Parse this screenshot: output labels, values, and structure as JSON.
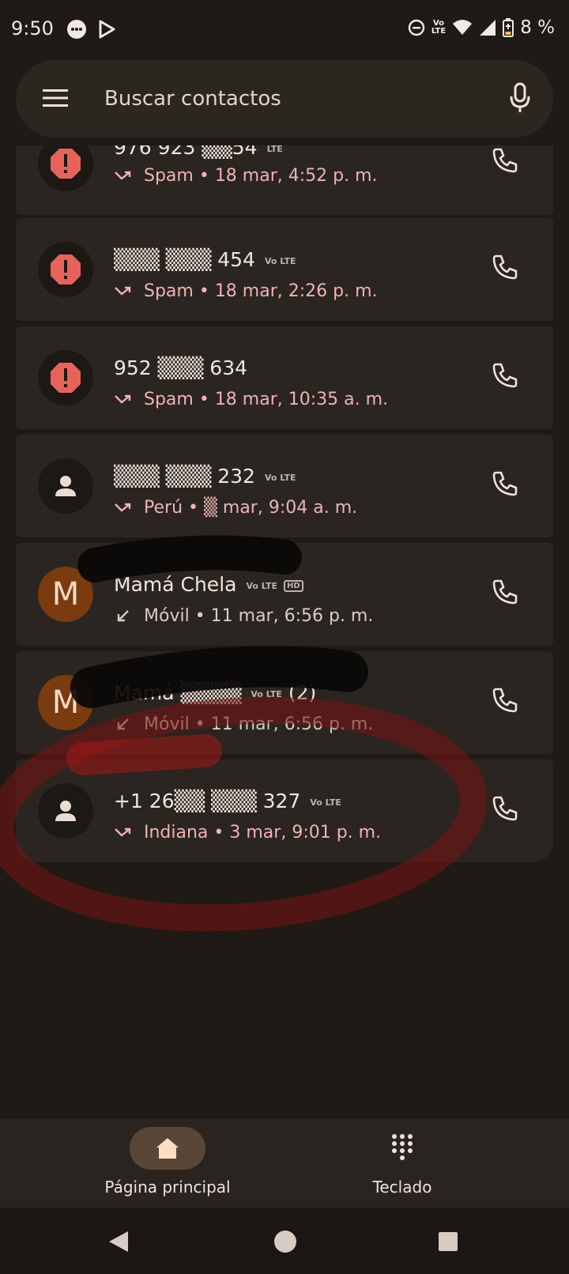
{
  "status_bar": {
    "time": "9:50",
    "battery": "8 %",
    "network_badge": "Vo\nLTE",
    "icons": [
      "messages-icon",
      "play-store-icon",
      "dnd-icon",
      "volte-icon",
      "wifi-icon",
      "signal-icon",
      "battery-icon"
    ]
  },
  "search": {
    "placeholder": "Buscar contactos"
  },
  "calls": [
    {
      "name": "976 923 ▒▒54",
      "type": "Spam",
      "when": "18 mar, 4:52 p. m.",
      "avatar": "spam",
      "badge": "LTE",
      "direction": "missed"
    },
    {
      "name": "▒▒▒ ▒▒▒ 454",
      "type": "Spam",
      "when": "18 mar, 2:26 p. m.",
      "avatar": "spam",
      "badge": "Vo LTE",
      "direction": "missed"
    },
    {
      "name": "952 ▒▒▒ 634",
      "type": "Spam",
      "when": "18 mar, 10:35 a. m.",
      "avatar": "spam",
      "badge": "",
      "direction": "missed"
    },
    {
      "name": "▒▒▒ ▒▒▒ 232",
      "type": "Perú",
      "when": "▒ mar, 9:04 a. m.",
      "avatar": "person",
      "badge": "Vo LTE",
      "direction": "missed"
    },
    {
      "name": "Mamá Chela",
      "type": "Móvil",
      "when": "11 mar, 6:56 p. m.",
      "avatar": "M",
      "badge": "Vo LTE",
      "hd": "HD",
      "direction": "incoming"
    },
    {
      "name": "Mamá ▒▒▒▒",
      "count": "(2)",
      "type": "Móvil",
      "when": "11 mar, 6:56 p. m.",
      "avatar": "M",
      "badge": "Vo LTE",
      "direction": "incoming"
    },
    {
      "name": "+1 26▒▒ ▒▒▒ 327",
      "type": "Indiana",
      "when": "3 mar, 9:01 p. m.",
      "avatar": "person",
      "badge": "Vo LTE",
      "direction": "missed"
    }
  ],
  "bottom_nav": {
    "home": "Página principal",
    "keypad": "Teclado"
  },
  "colors": {
    "accent_red": "#f0b2b3",
    "spam_red": "#e8625a",
    "contact_brown": "#7a3b0e"
  }
}
